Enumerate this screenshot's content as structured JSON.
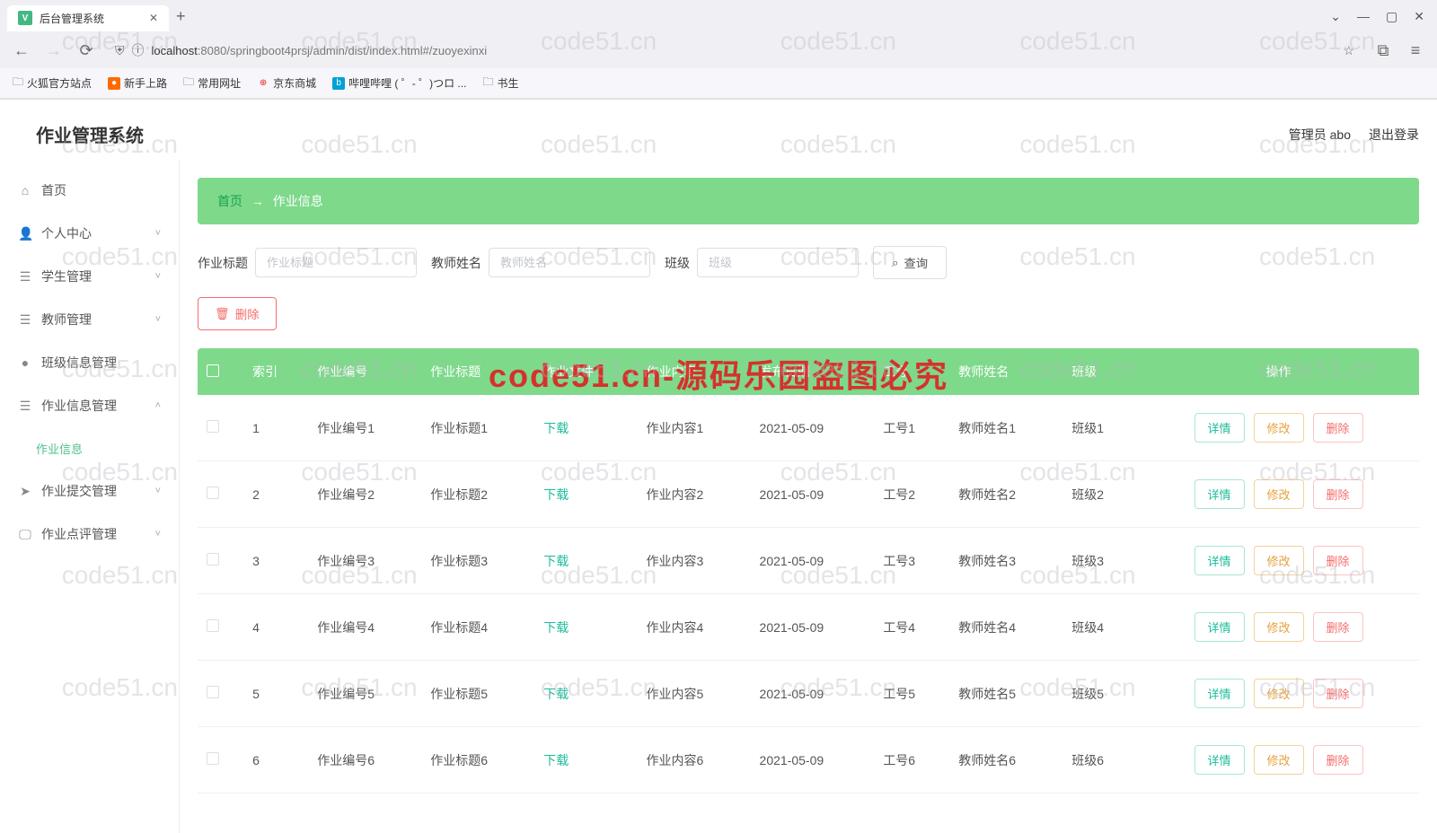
{
  "browser": {
    "tab_title": "后台管理系统",
    "url_host": "localhost",
    "url_port": ":8080",
    "url_path": "/springboot4prsj/admin/dist/index.html#/zuoyexinxi",
    "bookmarks": [
      "火狐官方站点",
      "新手上路",
      "常用网址",
      "京东商城",
      "哔哩哔哩 ( ゜- ゜)つロ ...",
      "书生"
    ]
  },
  "app": {
    "title": "作业管理系统",
    "user_label": "管理员 abo",
    "logout": "退出登录"
  },
  "sidebar": {
    "items": [
      {
        "icon": "home",
        "label": "首页"
      },
      {
        "icon": "user",
        "label": "个人中心",
        "expandable": true
      },
      {
        "icon": "list",
        "label": "学生管理",
        "expandable": true
      },
      {
        "icon": "list",
        "label": "教师管理",
        "expandable": true
      },
      {
        "icon": "dot",
        "label": "班级信息管理"
      },
      {
        "icon": "list",
        "label": "作业信息管理",
        "expandable": true,
        "expanded": true
      },
      {
        "icon": "",
        "label": "作业信息",
        "sub": true,
        "active": true
      },
      {
        "icon": "send",
        "label": "作业提交管理",
        "expandable": true
      },
      {
        "icon": "monitor",
        "label": "作业点评管理",
        "expandable": true
      }
    ]
  },
  "breadcrumb": {
    "home": "首页",
    "arrow": "→",
    "current": "作业信息"
  },
  "search": {
    "title_label": "作业标题",
    "title_ph": "作业标题",
    "teacher_label": "教师姓名",
    "teacher_ph": "教师姓名",
    "class_label": "班级",
    "class_ph": "班级",
    "query": "查询"
  },
  "actions": {
    "delete": "删除"
  },
  "table": {
    "headers": [
      "",
      "索引",
      "作业编号",
      "作业标题",
      "作业文件",
      "作业内容",
      "发布日期",
      "工号",
      "教师姓名",
      "班级",
      "操作"
    ],
    "download": "下载",
    "ops": {
      "detail": "详情",
      "edit": "修改",
      "del": "删除"
    },
    "rows": [
      {
        "idx": "1",
        "bh": "作业编号1",
        "bt": "作业标题1",
        "nr": "作业内容1",
        "rq": "2021-05-09",
        "gh": "工号1",
        "js": "教师姓名1",
        "bj": "班级1"
      },
      {
        "idx": "2",
        "bh": "作业编号2",
        "bt": "作业标题2",
        "nr": "作业内容2",
        "rq": "2021-05-09",
        "gh": "工号2",
        "js": "教师姓名2",
        "bj": "班级2"
      },
      {
        "idx": "3",
        "bh": "作业编号3",
        "bt": "作业标题3",
        "nr": "作业内容3",
        "rq": "2021-05-09",
        "gh": "工号3",
        "js": "教师姓名3",
        "bj": "班级3"
      },
      {
        "idx": "4",
        "bh": "作业编号4",
        "bt": "作业标题4",
        "nr": "作业内容4",
        "rq": "2021-05-09",
        "gh": "工号4",
        "js": "教师姓名4",
        "bj": "班级4"
      },
      {
        "idx": "5",
        "bh": "作业编号5",
        "bt": "作业标题5",
        "nr": "作业内容5",
        "rq": "2021-05-09",
        "gh": "工号5",
        "js": "教师姓名5",
        "bj": "班级5"
      },
      {
        "idx": "6",
        "bh": "作业编号6",
        "bt": "作业标题6",
        "nr": "作业内容6",
        "rq": "2021-05-09",
        "gh": "工号6",
        "js": "教师姓名6",
        "bj": "班级6"
      }
    ]
  },
  "watermark": {
    "text": "code51.cn",
    "red": "code51.cn-源码乐园盗图必究"
  }
}
